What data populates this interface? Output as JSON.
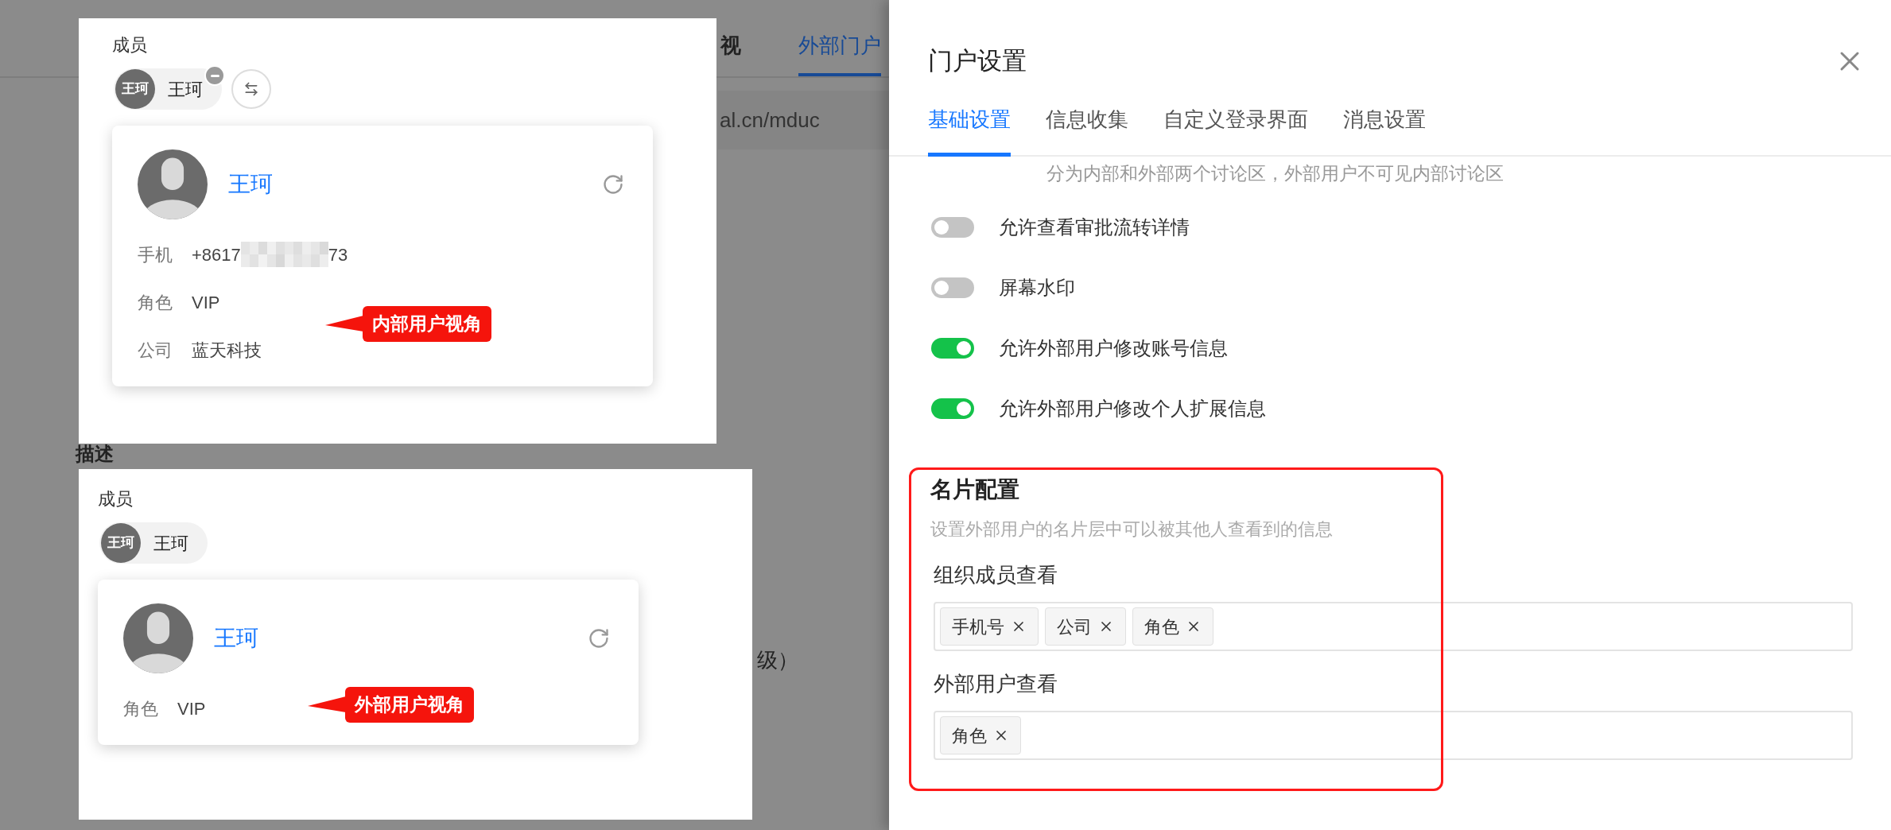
{
  "background": {
    "tabs": [
      {
        "label": "视",
        "selected": false
      },
      {
        "label": "外部门户",
        "selected": true
      }
    ],
    "url_fragment": "al.cn/mduc",
    "field_label": "描述",
    "text_fragment": "级）"
  },
  "member_views": [
    {
      "section_label": "成员",
      "chip": {
        "avatar_text": "王珂",
        "name": "王珂",
        "removable": true,
        "switch_button": true
      },
      "card": {
        "name": "王珂",
        "fields": [
          {
            "label": "手机",
            "kind": "masked",
            "value": "+8617",
            "value_end": "73"
          },
          {
            "label": "角色",
            "kind": "plain",
            "value": "VIP"
          },
          {
            "label": "公司",
            "kind": "plain",
            "value": "蓝天科技"
          }
        ]
      },
      "callout": "内部用户视角"
    },
    {
      "section_label": "成员",
      "chip": {
        "avatar_text": "王珂",
        "name": "王珂",
        "removable": false,
        "switch_button": false
      },
      "card": {
        "name": "王珂",
        "fields": [
          {
            "label": "角色",
            "kind": "plain",
            "value": "VIP"
          }
        ]
      },
      "callout": "外部用户视角"
    }
  ],
  "drawer": {
    "title": "门户设置",
    "tabs": [
      {
        "label": "基础设置",
        "selected": true
      },
      {
        "label": "信息收集",
        "selected": false
      },
      {
        "label": "自定义登录界面",
        "selected": false
      },
      {
        "label": "消息设置",
        "selected": false
      }
    ],
    "hint": "分为内部和外部两个讨论区，外部用户不可见内部讨论区",
    "toggles": [
      {
        "label": "允许查看审批流转详情",
        "on": false
      },
      {
        "label": "屏幕水印",
        "on": false
      },
      {
        "label": "允许外部用户修改账号信息",
        "on": true
      },
      {
        "label": "允许外部用户修改个人扩展信息",
        "on": true
      }
    ],
    "card_config": {
      "title": "名片配置",
      "description": "设置外部用户的名片层中可以被其他人查看到的信息",
      "groups": [
        {
          "label": "组织成员查看",
          "tags": [
            "手机号",
            "公司",
            "角色"
          ]
        },
        {
          "label": "外部用户查看",
          "tags": [
            "角色"
          ]
        }
      ]
    }
  }
}
